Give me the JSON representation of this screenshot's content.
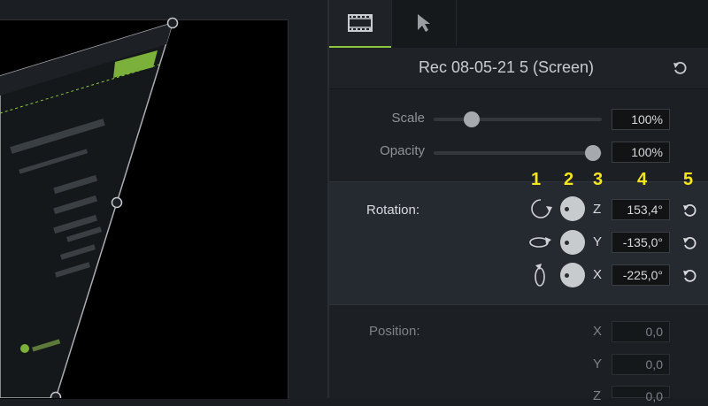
{
  "tabs": [
    {
      "name": "visual-properties",
      "icon": "film-icon",
      "active": true
    },
    {
      "name": "cursor-properties",
      "icon": "cursor-icon",
      "active": false
    }
  ],
  "header": {
    "title": "Rec 08-05-21 5 (Screen)"
  },
  "scale": {
    "label": "Scale",
    "value": "100%",
    "level": 0.25
  },
  "opacity": {
    "label": "Opacity",
    "value": "100%",
    "level": 1.0
  },
  "rotation": {
    "label": "Rotation:",
    "markers": [
      "1",
      "2",
      "3",
      "4",
      "5"
    ],
    "rows": [
      {
        "axis": "Z",
        "value": "153,4°"
      },
      {
        "axis": "Y",
        "value": "-135,0°"
      },
      {
        "axis": "X",
        "value": "-225,0°"
      }
    ]
  },
  "position": {
    "label": "Position:",
    "rows": [
      {
        "axis": "X",
        "value": "0,0"
      },
      {
        "axis": "Y",
        "value": "0,0"
      },
      {
        "axis": "Z",
        "value": "0,0"
      }
    ]
  },
  "colors": {
    "accent": "#8cc63f",
    "marker": "#f6e51c"
  }
}
